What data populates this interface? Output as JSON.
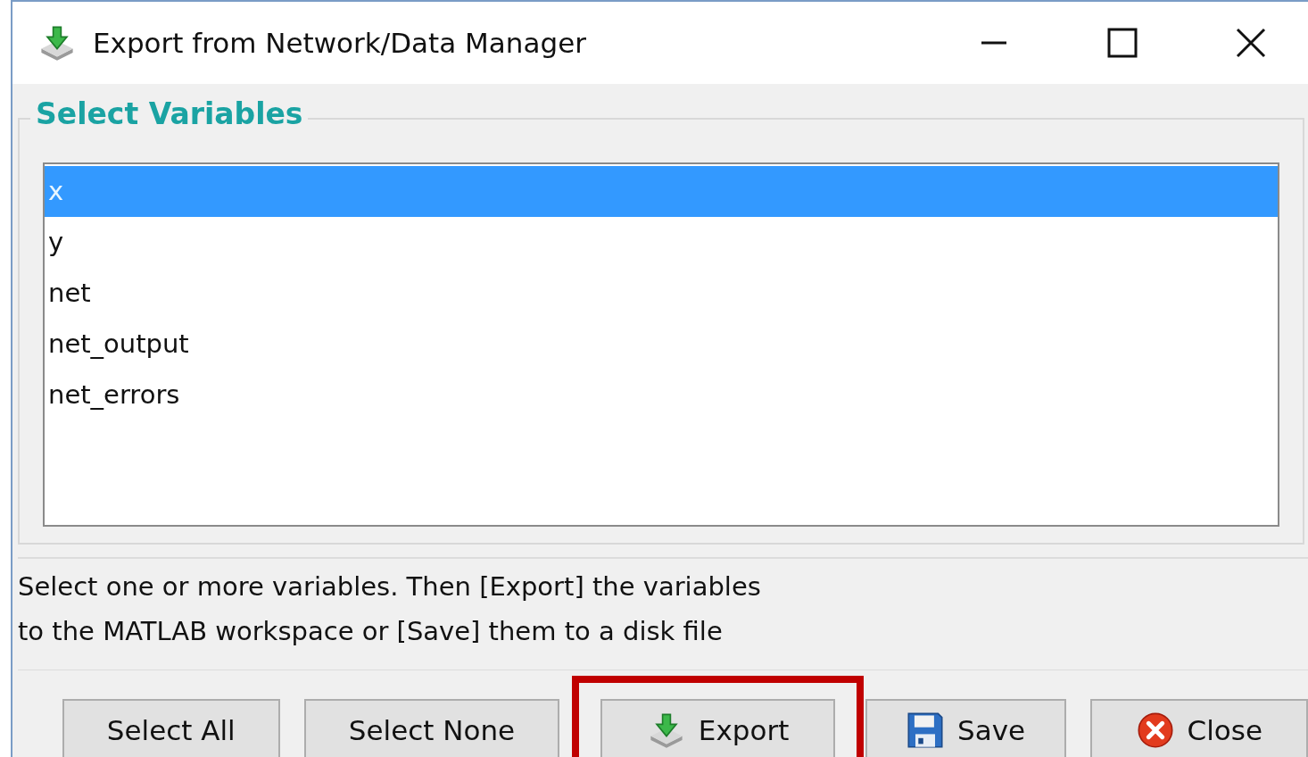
{
  "window": {
    "title": "Export from Network/Data Manager"
  },
  "group": {
    "title": "Select Variables"
  },
  "variables": [
    {
      "name": "x",
      "selected": true
    },
    {
      "name": "y",
      "selected": false
    },
    {
      "name": "net",
      "selected": false
    },
    {
      "name": "net_output",
      "selected": false
    },
    {
      "name": "net_errors",
      "selected": false
    }
  ],
  "help_lines": [
    "Select one or more variables. Then [Export] the variables",
    "to the MATLAB workspace or [Save] them to a disk file"
  ],
  "buttons": [
    {
      "label": "Select All",
      "kind": "plain",
      "highlighted": false
    },
    {
      "label": "Select None",
      "kind": "plain",
      "highlighted": false
    },
    {
      "label": "Export",
      "kind": "export",
      "highlighted": true
    },
    {
      "label": "Save",
      "kind": "save",
      "highlighted": false
    },
    {
      "label": "Close",
      "kind": "close",
      "highlighted": false
    }
  ]
}
